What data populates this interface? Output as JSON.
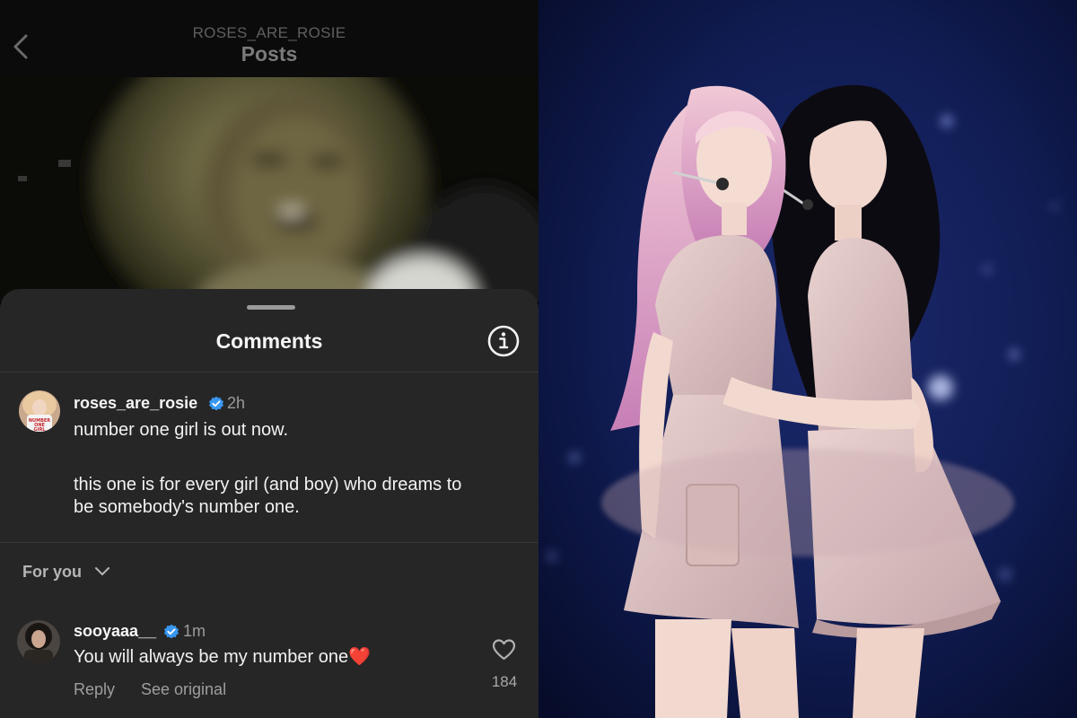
{
  "header": {
    "account_name": "ROSES_ARE_ROSIE",
    "title": "Posts"
  },
  "comments_sheet": {
    "title": "Comments",
    "caption": {
      "username": "roses_are_rosie",
      "time": "2h",
      "text_line1": "number one girl is out now.",
      "text_line2": "this one is for every girl (and boy) who dreams to",
      "text_line3": "be somebody's number one."
    },
    "filter_label": "For you",
    "comment": {
      "username": "sooyaaa__",
      "time": "1m",
      "text": "You will always be my number one",
      "emoji": "❤️",
      "like_count": "184",
      "reply_label": "Reply",
      "see_original_label": "See original"
    }
  },
  "colors": {
    "sheet_background": "#262626",
    "verified_badge": "#3897f0",
    "heart_emoji": "#e0142e",
    "stage_background": "#0d1740"
  },
  "icons": {
    "back": "back-arrow-icon",
    "info": "info-icon",
    "verified": "verified-badge-icon",
    "chevron": "chevron-down-icon",
    "like": "heart-outline-icon"
  }
}
